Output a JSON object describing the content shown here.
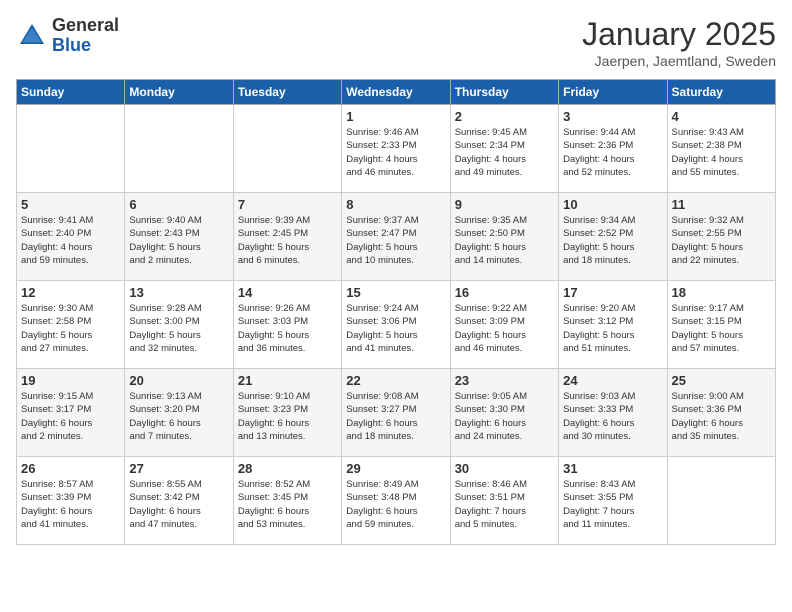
{
  "logo": {
    "line1": "General",
    "line2": "Blue"
  },
  "title": "January 2025",
  "subtitle": "Jaerpen, Jaemtland, Sweden",
  "days_of_week": [
    "Sunday",
    "Monday",
    "Tuesday",
    "Wednesday",
    "Thursday",
    "Friday",
    "Saturday"
  ],
  "weeks": [
    [
      {
        "day": "",
        "info": ""
      },
      {
        "day": "",
        "info": ""
      },
      {
        "day": "",
        "info": ""
      },
      {
        "day": "1",
        "info": "Sunrise: 9:46 AM\nSunset: 2:33 PM\nDaylight: 4 hours\nand 46 minutes."
      },
      {
        "day": "2",
        "info": "Sunrise: 9:45 AM\nSunset: 2:34 PM\nDaylight: 4 hours\nand 49 minutes."
      },
      {
        "day": "3",
        "info": "Sunrise: 9:44 AM\nSunset: 2:36 PM\nDaylight: 4 hours\nand 52 minutes."
      },
      {
        "day": "4",
        "info": "Sunrise: 9:43 AM\nSunset: 2:38 PM\nDaylight: 4 hours\nand 55 minutes."
      }
    ],
    [
      {
        "day": "5",
        "info": "Sunrise: 9:41 AM\nSunset: 2:40 PM\nDaylight: 4 hours\nand 59 minutes."
      },
      {
        "day": "6",
        "info": "Sunrise: 9:40 AM\nSunset: 2:43 PM\nDaylight: 5 hours\nand 2 minutes."
      },
      {
        "day": "7",
        "info": "Sunrise: 9:39 AM\nSunset: 2:45 PM\nDaylight: 5 hours\nand 6 minutes."
      },
      {
        "day": "8",
        "info": "Sunrise: 9:37 AM\nSunset: 2:47 PM\nDaylight: 5 hours\nand 10 minutes."
      },
      {
        "day": "9",
        "info": "Sunrise: 9:35 AM\nSunset: 2:50 PM\nDaylight: 5 hours\nand 14 minutes."
      },
      {
        "day": "10",
        "info": "Sunrise: 9:34 AM\nSunset: 2:52 PM\nDaylight: 5 hours\nand 18 minutes."
      },
      {
        "day": "11",
        "info": "Sunrise: 9:32 AM\nSunset: 2:55 PM\nDaylight: 5 hours\nand 22 minutes."
      }
    ],
    [
      {
        "day": "12",
        "info": "Sunrise: 9:30 AM\nSunset: 2:58 PM\nDaylight: 5 hours\nand 27 minutes."
      },
      {
        "day": "13",
        "info": "Sunrise: 9:28 AM\nSunset: 3:00 PM\nDaylight: 5 hours\nand 32 minutes."
      },
      {
        "day": "14",
        "info": "Sunrise: 9:26 AM\nSunset: 3:03 PM\nDaylight: 5 hours\nand 36 minutes."
      },
      {
        "day": "15",
        "info": "Sunrise: 9:24 AM\nSunset: 3:06 PM\nDaylight: 5 hours\nand 41 minutes."
      },
      {
        "day": "16",
        "info": "Sunrise: 9:22 AM\nSunset: 3:09 PM\nDaylight: 5 hours\nand 46 minutes."
      },
      {
        "day": "17",
        "info": "Sunrise: 9:20 AM\nSunset: 3:12 PM\nDaylight: 5 hours\nand 51 minutes."
      },
      {
        "day": "18",
        "info": "Sunrise: 9:17 AM\nSunset: 3:15 PM\nDaylight: 5 hours\nand 57 minutes."
      }
    ],
    [
      {
        "day": "19",
        "info": "Sunrise: 9:15 AM\nSunset: 3:17 PM\nDaylight: 6 hours\nand 2 minutes."
      },
      {
        "day": "20",
        "info": "Sunrise: 9:13 AM\nSunset: 3:20 PM\nDaylight: 6 hours\nand 7 minutes."
      },
      {
        "day": "21",
        "info": "Sunrise: 9:10 AM\nSunset: 3:23 PM\nDaylight: 6 hours\nand 13 minutes."
      },
      {
        "day": "22",
        "info": "Sunrise: 9:08 AM\nSunset: 3:27 PM\nDaylight: 6 hours\nand 18 minutes."
      },
      {
        "day": "23",
        "info": "Sunrise: 9:05 AM\nSunset: 3:30 PM\nDaylight: 6 hours\nand 24 minutes."
      },
      {
        "day": "24",
        "info": "Sunrise: 9:03 AM\nSunset: 3:33 PM\nDaylight: 6 hours\nand 30 minutes."
      },
      {
        "day": "25",
        "info": "Sunrise: 9:00 AM\nSunset: 3:36 PM\nDaylight: 6 hours\nand 35 minutes."
      }
    ],
    [
      {
        "day": "26",
        "info": "Sunrise: 8:57 AM\nSunset: 3:39 PM\nDaylight: 6 hours\nand 41 minutes."
      },
      {
        "day": "27",
        "info": "Sunrise: 8:55 AM\nSunset: 3:42 PM\nDaylight: 6 hours\nand 47 minutes."
      },
      {
        "day": "28",
        "info": "Sunrise: 8:52 AM\nSunset: 3:45 PM\nDaylight: 6 hours\nand 53 minutes."
      },
      {
        "day": "29",
        "info": "Sunrise: 8:49 AM\nSunset: 3:48 PM\nDaylight: 6 hours\nand 59 minutes."
      },
      {
        "day": "30",
        "info": "Sunrise: 8:46 AM\nSunset: 3:51 PM\nDaylight: 7 hours\nand 5 minutes."
      },
      {
        "day": "31",
        "info": "Sunrise: 8:43 AM\nSunset: 3:55 PM\nDaylight: 7 hours\nand 11 minutes."
      },
      {
        "day": "",
        "info": ""
      }
    ]
  ]
}
